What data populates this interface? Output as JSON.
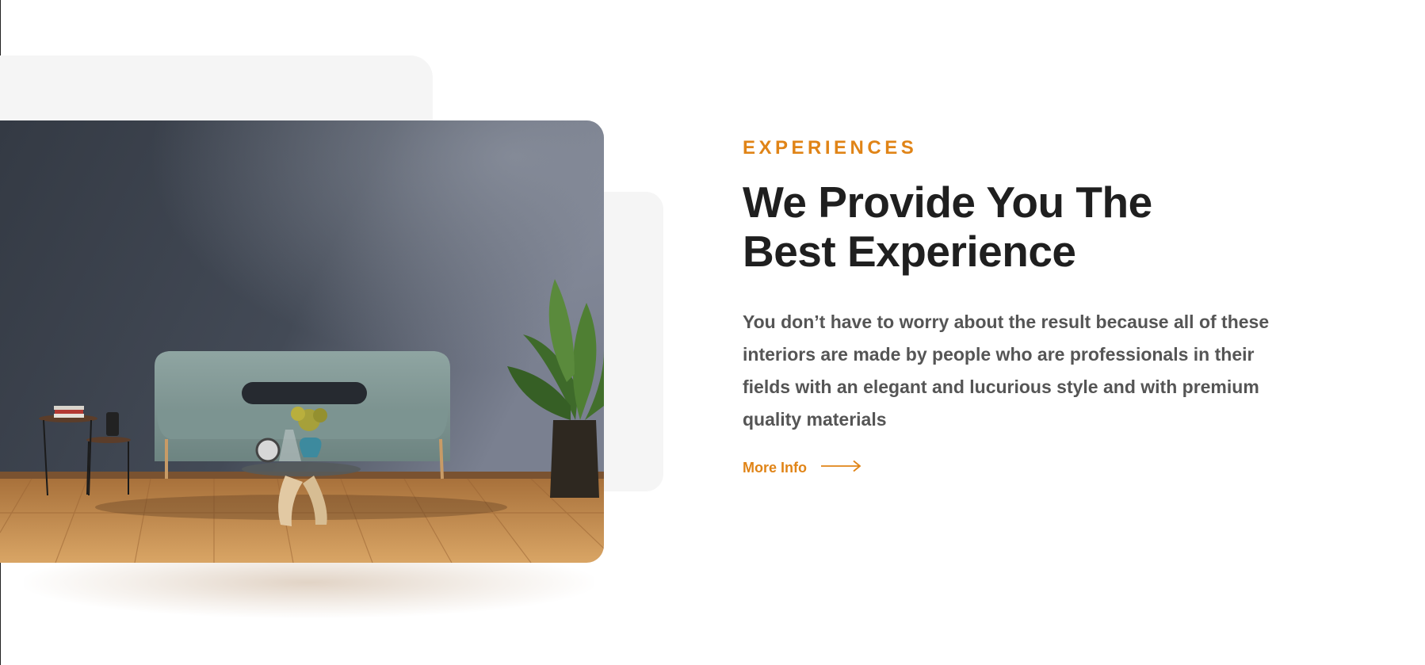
{
  "section": {
    "eyebrow": "EXPERIENCES",
    "heading_line1": "We Provide You The",
    "heading_line2": "Best Experience",
    "body": "You don’t have to worry about the result because all of these interiors are made by people who are professionals in their fields with an elegant and lucurious style and with premium quality materials",
    "cta_label": "More Info"
  },
  "image": {
    "subject": "living-room-sofa-photo"
  },
  "colors": {
    "accent": "#e08417",
    "heading": "#1f1f1f",
    "body": "#555555",
    "panel": "#f5f5f5"
  },
  "icons": {
    "cta": "arrow-right-icon"
  }
}
